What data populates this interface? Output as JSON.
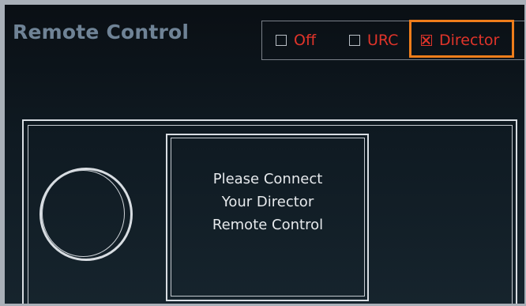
{
  "header": {
    "title": "Remote Control"
  },
  "mode_selector": {
    "options": [
      {
        "label": "Off",
        "checked": false
      },
      {
        "label": "URC",
        "checked": false
      },
      {
        "label": "Director",
        "checked": true
      }
    ]
  },
  "device": {
    "message_line1": "Please Connect",
    "message_line2": "Your Director",
    "message_line3": "Remote Control"
  },
  "colors": {
    "accent_red": "#e0342a",
    "highlight_orange": "#ee7d1b",
    "title_gray": "#6f8396"
  }
}
